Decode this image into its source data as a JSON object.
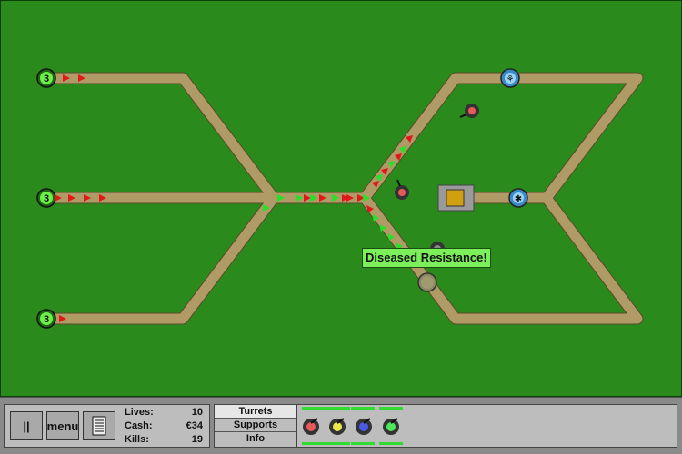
{
  "spawn_points": [
    {
      "count": "3"
    },
    {
      "count": "3"
    },
    {
      "count": "3"
    }
  ],
  "wave_banner": "Diseased Resistance!",
  "hud": {
    "pause_label": "||",
    "menu_label": "menu",
    "notes_icon": "notes-icon",
    "stats": {
      "lives_label": "Lives:",
      "lives_value": "10",
      "cash_label": "Cash:",
      "cash_value": "€34",
      "kills_label": "Kills:",
      "kills_value": "19"
    },
    "tabs": [
      {
        "label": "Turrets",
        "active": true
      },
      {
        "label": "Supports",
        "active": false
      },
      {
        "label": "Info",
        "active": false
      }
    ],
    "turrets": [
      {
        "name": "red-turret",
        "color": "#e85a5a"
      },
      {
        "name": "yellow-turret",
        "color": "#e8e84a"
      },
      {
        "name": "blue-turret",
        "color": "#4a5ae8"
      },
      {
        "name": "green-turret",
        "color": "#4ae85a"
      }
    ]
  },
  "colors": {
    "grass": "#2a8a1c",
    "path": "#b09a66",
    "enemy_red": "#e01818",
    "enemy_green": "#28e028",
    "base": "#d1a010"
  }
}
